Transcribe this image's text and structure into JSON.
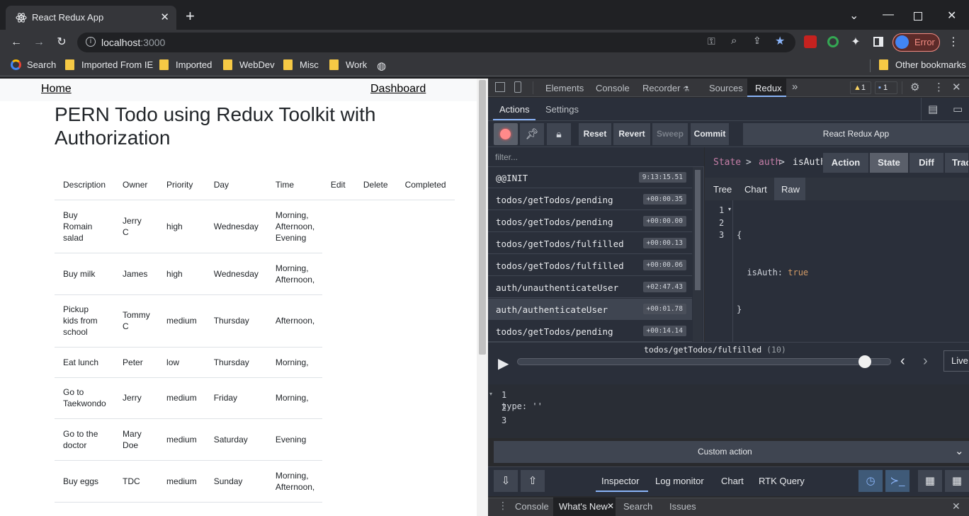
{
  "browser": {
    "tab_title": "React Redux App",
    "url_host": "localhost",
    "url_port": ":3000",
    "profile_label": "Error",
    "bookmarks": [
      "Search",
      "Imported From IE",
      "Imported",
      "WebDev",
      "Misc",
      "Work"
    ],
    "other_bookmarks": "Other bookmarks"
  },
  "page": {
    "nav_home": "Home",
    "nav_dashboard": "Dashboard",
    "title": "PERN Todo using Redux Toolkit with Authorization",
    "columns": [
      "Description",
      "Owner",
      "Priority",
      "Day",
      "Time",
      "Edit",
      "Delete",
      "Completed"
    ],
    "rows": [
      {
        "description": "Buy Romain salad",
        "owner": "Jerry C",
        "priority": "high",
        "day": "Wednesday",
        "time": "Morning, Afternoon, Evening"
      },
      {
        "description": "Buy milk",
        "owner": "James",
        "priority": "high",
        "day": "Wednesday",
        "time": "Morning, Afternoon,"
      },
      {
        "description": "Pickup kids from school",
        "owner": "Tommy C",
        "priority": "medium",
        "day": "Thursday",
        "time": "Afternoon,"
      },
      {
        "description": "Eat lunch",
        "owner": "Peter",
        "priority": "low",
        "day": "Thursday",
        "time": "Morning,"
      },
      {
        "description": "Go to Taekwondo",
        "owner": "Jerry",
        "priority": "medium",
        "day": "Friday",
        "time": "Morning,"
      },
      {
        "description": "Go to the doctor",
        "owner": "Mary Doe",
        "priority": "medium",
        "day": "Saturday",
        "time": "Evening"
      },
      {
        "description": "Buy eggs",
        "owner": "TDC",
        "priority": "medium",
        "day": "Sunday",
        "time": "Morning, Afternoon,"
      }
    ]
  },
  "devtools": {
    "tabs": [
      "Elements",
      "Console",
      "Recorder",
      "Sources",
      "Redux"
    ],
    "warning_count": "1",
    "message_count": "1",
    "subtabs": [
      "Actions",
      "Settings"
    ],
    "buttons": [
      "Reset",
      "Revert",
      "Sweep",
      "Commit"
    ],
    "instance": "React Redux App",
    "filter_placeholder": "filter...",
    "actions": [
      {
        "name": "@@INIT",
        "time": "9:13:15.51"
      },
      {
        "name": "todos/getTodos/pending",
        "time": "+00:00.35"
      },
      {
        "name": "todos/getTodos/pending",
        "time": "+00:00.00"
      },
      {
        "name": "todos/getTodos/fulfilled",
        "time": "+00:00.13"
      },
      {
        "name": "todos/getTodos/fulfilled",
        "time": "+00:00.06"
      },
      {
        "name": "auth/unauthenticateUser",
        "time": "+02:47.43"
      },
      {
        "name": "auth/authenticateUser",
        "time": "+00:01.78"
      },
      {
        "name": "todos/getTodos/pending",
        "time": "+00:14.14"
      }
    ],
    "breadcrumb": [
      "State",
      "auth",
      "isAuth"
    ],
    "inspector_tabs": [
      "Action",
      "State",
      "Diff",
      "Trace"
    ],
    "view_tabs": [
      "Tree",
      "Chart",
      "Raw"
    ],
    "raw_lines": [
      "1",
      "2",
      "3"
    ],
    "raw_code": [
      "{",
      "  isAuth: true",
      "}"
    ],
    "slider_action": "todos/getTodos/fulfilled",
    "slider_count": "(10)",
    "slider_position": 0.93,
    "live_label": "Live",
    "editor_lines": [
      "1",
      "2",
      "3"
    ],
    "editor_code": "type: ''",
    "custom_action": "Custom action",
    "footer_tabs": [
      "Inspector",
      "Log monitor",
      "Chart",
      "RTK Query"
    ],
    "drawer_tabs": [
      "Console",
      "What's New",
      "Search",
      "Issues"
    ]
  }
}
